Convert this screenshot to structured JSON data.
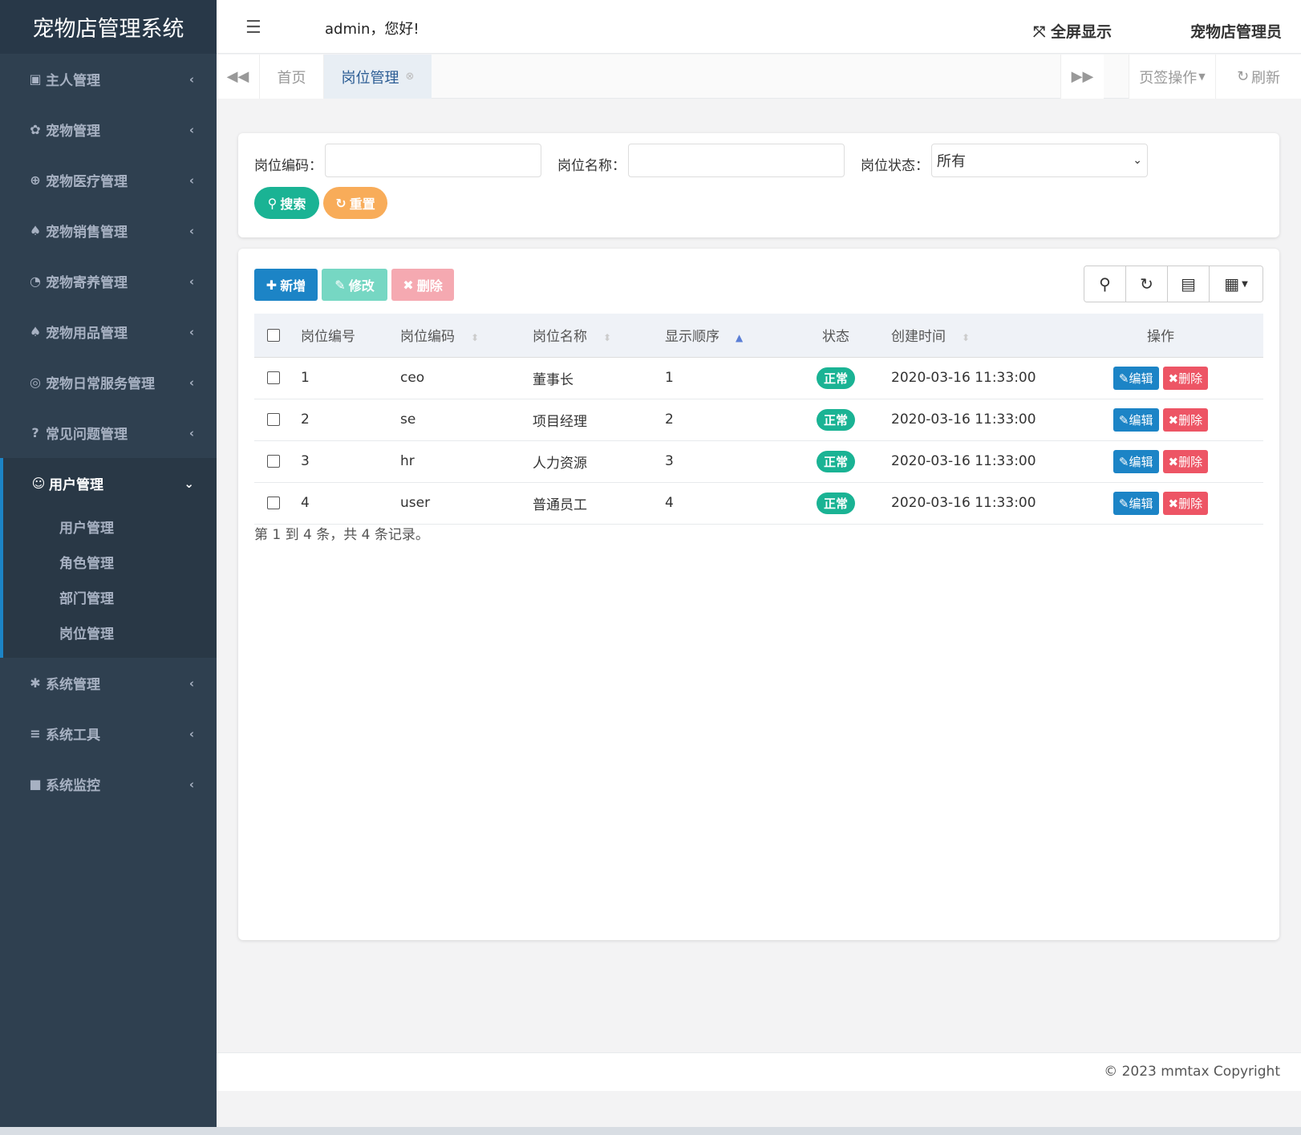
{
  "brand": "宠物店管理系统",
  "header": {
    "welcome": "admin，您好!",
    "fullscreen_label": "全屏显示",
    "user_name": "宠物店管理员"
  },
  "sidebar": {
    "items": [
      {
        "label": "主人管理",
        "icon": "id-card-icon"
      },
      {
        "label": "宠物管理",
        "icon": "paw-icon"
      },
      {
        "label": "宠物医疗管理",
        "icon": "plus-circle-icon"
      },
      {
        "label": "宠物销售管理",
        "icon": "bell-icon"
      },
      {
        "label": "宠物寄养管理",
        "icon": "wifi-icon"
      },
      {
        "label": "宠物用品管理",
        "icon": "bell-icon"
      },
      {
        "label": "宠物日常服务管理",
        "icon": "life-ring-icon"
      },
      {
        "label": "常见问题管理",
        "icon": "question-circle-icon"
      }
    ],
    "expanded_group": {
      "label": "用户管理",
      "icon": "user-circle-icon",
      "children": [
        "用户管理",
        "角色管理",
        "部门管理",
        "岗位管理"
      ]
    },
    "items_after": [
      {
        "label": "系统管理",
        "icon": "gear-icon"
      },
      {
        "label": "系统工具",
        "icon": "bars-icon"
      },
      {
        "label": "系统监控",
        "icon": "video-camera-icon"
      }
    ]
  },
  "tabs": {
    "home": "首页",
    "active": "岗位管理",
    "tab_ops": "页签操作",
    "refresh": "刷新"
  },
  "search": {
    "post_code_label": "岗位编码：",
    "post_code_value": "",
    "post_name_label": "岗位名称：",
    "post_name_value": "",
    "status_label": "岗位状态：",
    "status_value": "所有",
    "search_button": "搜索",
    "reset_button": "重置"
  },
  "toolbar": {
    "add": "新增",
    "edit": "修改",
    "delete": "删除"
  },
  "table": {
    "columns": [
      "岗位编号",
      "岗位编码",
      "岗位名称",
      "显示顺序",
      "状态",
      "创建时间",
      "操作"
    ],
    "rows": [
      {
        "id": "1",
        "code": "ceo",
        "name": "董事长",
        "order": "1",
        "status": "正常",
        "created": "2020-03-16 11:33:00"
      },
      {
        "id": "2",
        "code": "se",
        "name": "项目经理",
        "order": "2",
        "status": "正常",
        "created": "2020-03-16 11:33:00"
      },
      {
        "id": "3",
        "code": "hr",
        "name": "人力资源",
        "order": "3",
        "status": "正常",
        "created": "2020-03-16 11:33:00"
      },
      {
        "id": "4",
        "code": "user",
        "name": "普通员工",
        "order": "4",
        "status": "正常",
        "created": "2020-03-16 11:33:00"
      }
    ],
    "row_edit": "编辑",
    "row_delete": "删除",
    "page_info": "第 1 到 4 条，共 4 条记录。"
  },
  "footer": {
    "copyright": "© 2023 mmtax Copyright"
  },
  "colors": {
    "sidebar_bg": "#2f4050",
    "primary": "#1c84c6",
    "success": "#1ab394",
    "warning": "#f8ac59",
    "danger": "#ed5565"
  }
}
